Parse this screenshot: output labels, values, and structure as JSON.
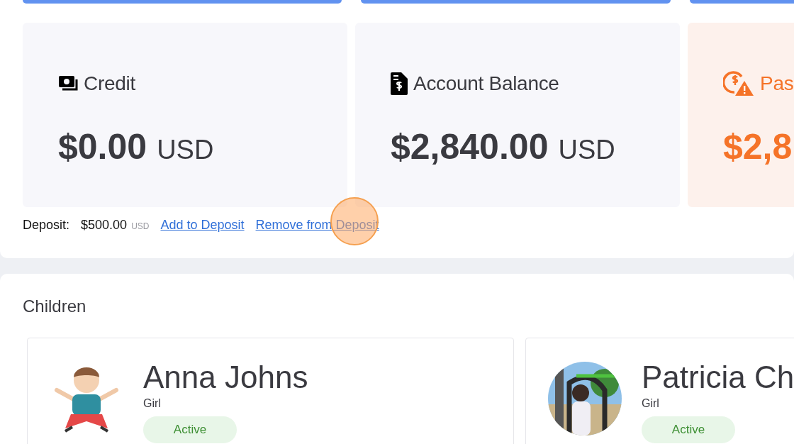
{
  "top_buttons": [
    {
      "kind": "button"
    },
    {
      "kind": "button"
    },
    {
      "kind": "button"
    }
  ],
  "stats": [
    {
      "kind": "credit",
      "title": "Credit",
      "amount": "$0.00",
      "currency": "USD"
    },
    {
      "kind": "balance",
      "title": "Account Balance",
      "amount": "$2,840.00",
      "currency": "USD"
    },
    {
      "kind": "past_due",
      "title": "Pas",
      "amount": "$2,8"
    }
  ],
  "deposit": {
    "label": "Deposit:",
    "amount": "$500.00",
    "currency": "USD",
    "links": [
      "Add to Deposit",
      "Remove from Deposit"
    ]
  },
  "click_marker": true,
  "children": {
    "title": "Children",
    "items": [
      {
        "name": "Anna Johns",
        "gender": "Girl",
        "status": "Active",
        "kind": "illustration"
      },
      {
        "name": "Patricia Ch",
        "gender": "Girl",
        "status": "Active",
        "kind": "picture"
      }
    ]
  }
}
